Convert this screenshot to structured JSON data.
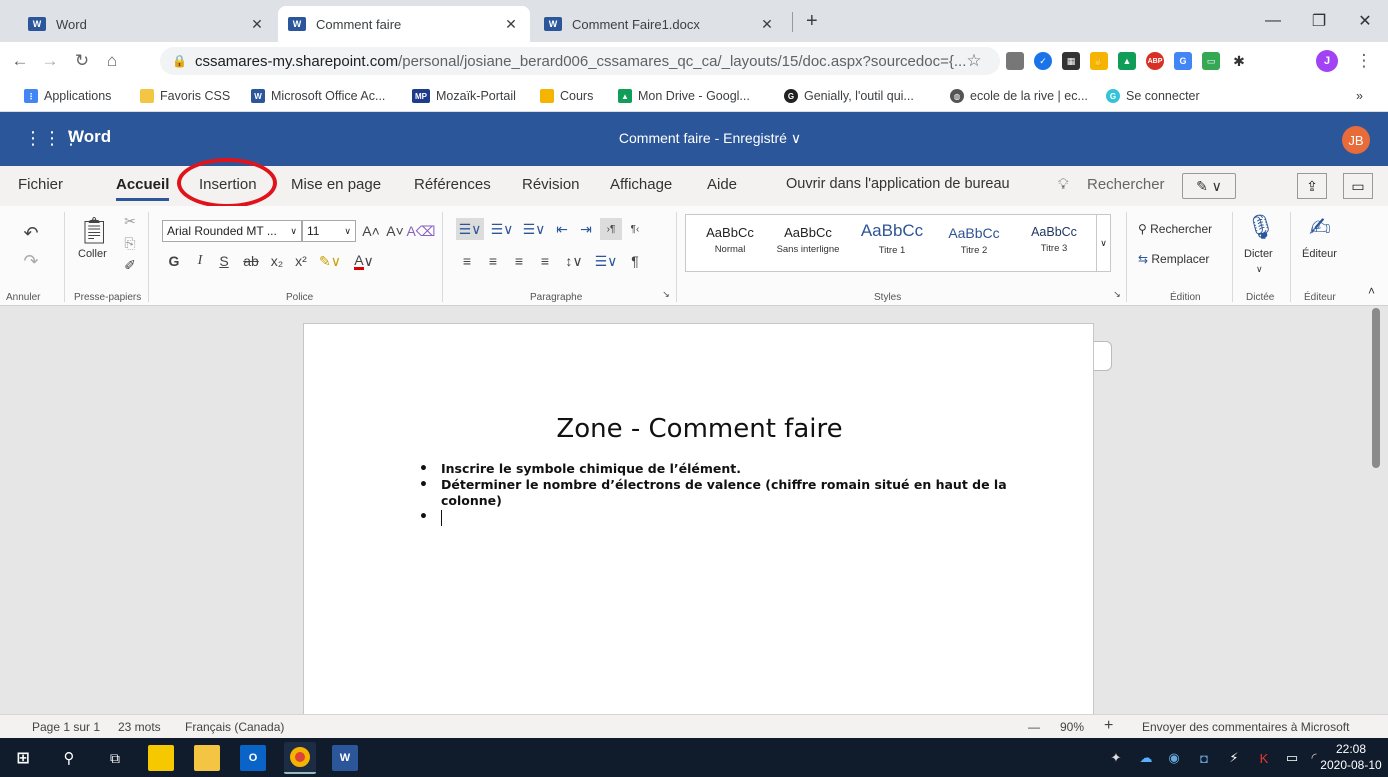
{
  "browser": {
    "tabs": [
      {
        "title": "Word"
      },
      {
        "title": "Comment faire"
      },
      {
        "title": "Comment Faire1.docx"
      }
    ],
    "new_tab": "+",
    "url_host": "cssamares-my.sharepoint.com",
    "url_path": "/personal/josiane_berard006_cssamares_qc_ca/_layouts/15/doc.aspx?sourcedoc={...",
    "profile_initial": "J",
    "bookmarks": [
      {
        "label": "Applications"
      },
      {
        "label": "Favoris CSS"
      },
      {
        "label": "Microsoft Office Ac..."
      },
      {
        "label": "Mozaïk-Portail"
      },
      {
        "label": "Cours"
      },
      {
        "label": "Mon Drive - Googl..."
      },
      {
        "label": "Genially, l'outil qui..."
      },
      {
        "label": "ecole de la rive | ec..."
      },
      {
        "label": "Se connecter"
      }
    ],
    "bookmarks_more": "»"
  },
  "word": {
    "app_name": "Word",
    "doc_title": "Comment faire - Enregistré ∨",
    "user_initials": "JB",
    "ribbon_tabs": [
      "Fichier",
      "Accueil",
      "Insertion",
      "Mise en page",
      "Références",
      "Révision",
      "Affichage",
      "Aide"
    ],
    "open_desktop": "Ouvrir dans l'application de bureau",
    "search_tab": "Rechercher",
    "font_name": "Arial Rounded MT ...",
    "font_size": "11",
    "paste_label": "Coller",
    "groups": [
      "Annuler",
      "Presse-papiers",
      "Police",
      "Paragraphe",
      "Styles",
      "Édition",
      "Dictée",
      "Éditeur"
    ],
    "styles": [
      {
        "sample": "AaBbCc",
        "name": "Normal"
      },
      {
        "sample": "AaBbCc",
        "name": "Sans interligne"
      },
      {
        "sample": "AaBbCc",
        "name": "Titre 1"
      },
      {
        "sample": "AaBbCc",
        "name": "Titre 2"
      },
      {
        "sample": "AaBbCc",
        "name": "Titre 3"
      }
    ],
    "find_label": "Rechercher",
    "replace_label": "Remplacer",
    "dictate_label": "Dicter",
    "editor_label": "Éditeur"
  },
  "document": {
    "heading": "Zone - Comment faire",
    "bullets": [
      "Inscrire le symbole chimique de l’élément.",
      "Déterminer le nombre d’électrons de valence (chiffre romain situé en haut de la colonne)"
    ]
  },
  "status": {
    "page": "Page 1 sur 1",
    "words": "23 mots",
    "language": "Français (Canada)",
    "zoom_minus": "—",
    "zoom": "90%",
    "zoom_plus": "+",
    "feedback": "Envoyer des commentaires à Microsoft"
  },
  "taskbar": {
    "time": "22:08",
    "date": "2020-08-10"
  },
  "colors": {
    "word_blue": "#2b579a",
    "annotation_red": "#e0131a",
    "avatar": "#e86b3a"
  }
}
